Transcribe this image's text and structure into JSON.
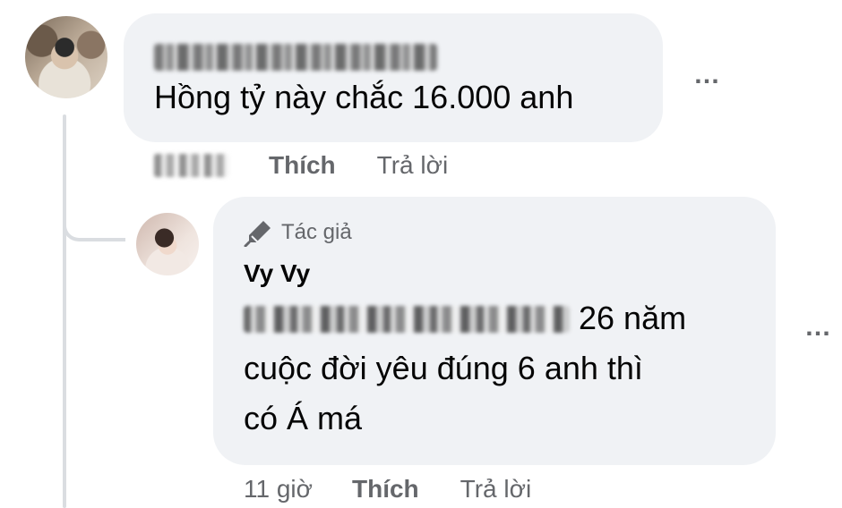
{
  "comment": {
    "author_name_blurred": true,
    "text": "Hồng tỷ này chắc 16.000 anh",
    "time_blurred": true,
    "like_label": "Thích",
    "reply_label": "Trả lời",
    "more_label": "…"
  },
  "reply": {
    "badge_icon": "pencil-icon",
    "badge_label": "Tác giả",
    "author_name": "Vy Vy",
    "text_blurred_prefix": true,
    "text_line1_suffix": "26 năm",
    "text_line2": "cuộc đời yêu đúng 6 anh thì",
    "text_line3": "có Á má",
    "time": "11 giờ",
    "like_label": "Thích",
    "reply_label": "Trả lời",
    "more_label": "…"
  },
  "colors": {
    "bubble_bg": "#f0f2f5",
    "secondary_text": "#65676b",
    "primary_text": "#050505",
    "thread_line": "#dadde1"
  }
}
